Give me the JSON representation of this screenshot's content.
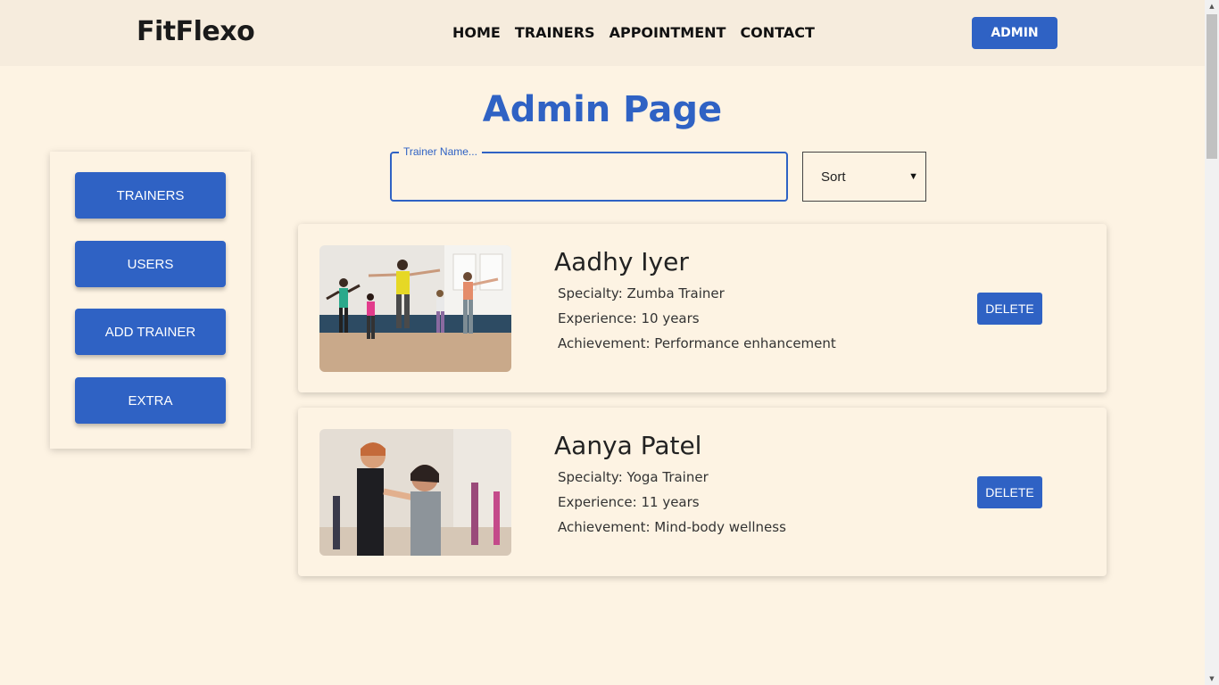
{
  "header": {
    "logo": "FitFlexo",
    "nav": [
      "HOME",
      "TRAINERS",
      "APPOINTMENT",
      "CONTACT"
    ],
    "admin_button": "ADMIN"
  },
  "page_title": "Admin Page",
  "sidebar": {
    "items": [
      "TRAINERS",
      "USERS",
      "ADD TRAINER",
      "EXTRA"
    ]
  },
  "search": {
    "label": "Trainer Name...",
    "value": ""
  },
  "sort": {
    "selected": "Sort"
  },
  "trainers": [
    {
      "name": "Aadhy Iyer",
      "specialty": "Specialty: Zumba Trainer",
      "experience": "Experience: 10 years",
      "achievement": "Achievement: Performance enhancement",
      "delete_label": "DELETE"
    },
    {
      "name": "Aanya Patel",
      "specialty": "Specialty: Yoga Trainer",
      "experience": "Experience: 11 years",
      "achievement": "Achievement: Mind-body wellness",
      "delete_label": "DELETE"
    }
  ],
  "colors": {
    "accent": "#2f62c4",
    "background": "#fdf3e3",
    "header_bg": "#f6ecdd"
  }
}
